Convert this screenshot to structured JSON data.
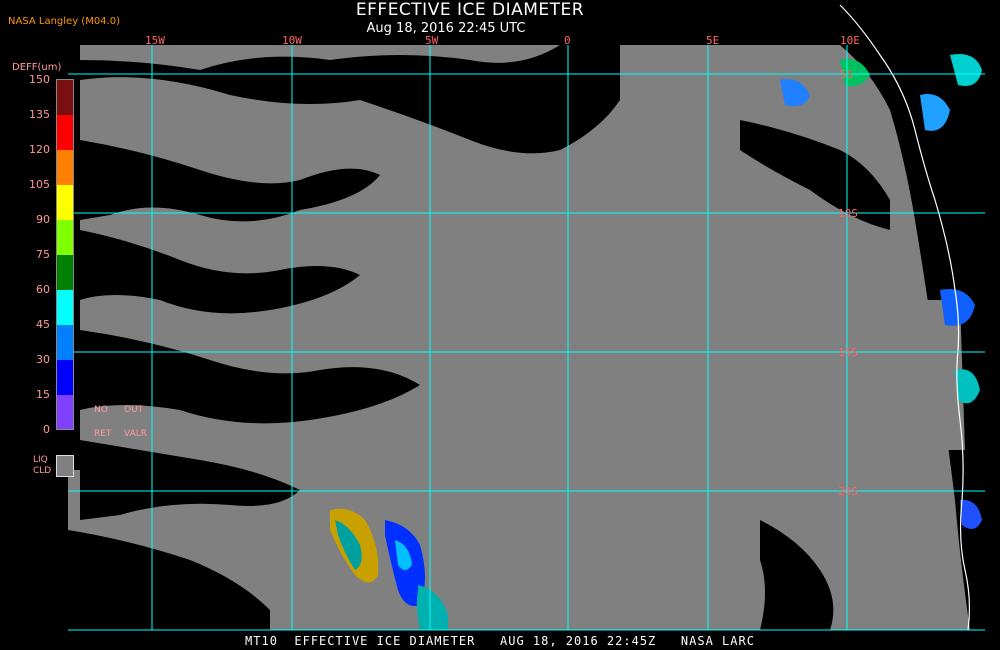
{
  "header": {
    "credit": "NASA Langley (M04.0)",
    "title": "EFFECTIVE ICE DIAMETER",
    "timestamp": "Aug 18, 2016 22:45 UTC"
  },
  "legend": {
    "title": "DEFF(um)",
    "ticks": [
      "150",
      "135",
      "120",
      "105",
      "90",
      "75",
      "60",
      "45",
      "30",
      "15",
      "0"
    ],
    "colors": [
      "#7a0f0f",
      "#ff0000",
      "#ff8000",
      "#ffff00",
      "#80ff00",
      "#008000",
      "#00ffff",
      "#0080ff",
      "#0000ff",
      "#8040ff"
    ],
    "codes": {
      "no": "NO",
      "out": "OUT",
      "ret": "RET",
      "valr": "VALR"
    },
    "liq_label_1": "LIQ",
    "liq_label_2": "CLD",
    "liq_color": "#808080"
  },
  "map": {
    "lon_labels": [
      "15W",
      "10W",
      "5W",
      "0",
      "5E",
      "10E"
    ],
    "lat_labels": [
      "5S",
      "10S",
      "15S",
      "20S"
    ],
    "grid_color": "#00ffff",
    "cloud_color": "#808080",
    "clear_color": "#000000"
  },
  "footer": {
    "text": "MT10  EFFECTIVE ICE DIAMETER   AUG 18, 2016 22:45Z   NASA LARC"
  }
}
